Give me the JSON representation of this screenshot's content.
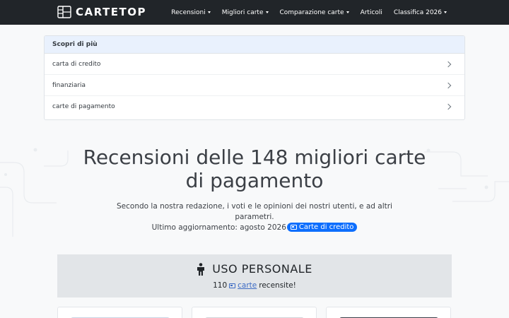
{
  "navbar": {
    "brand": "CARTETOP",
    "items": [
      {
        "label": "Recensioni",
        "dropdown": true
      },
      {
        "label": "Migliori carte",
        "dropdown": true
      },
      {
        "label": "Comparazione carte",
        "dropdown": true
      },
      {
        "label": "Articoli",
        "dropdown": false
      },
      {
        "label": "Classifica 2026",
        "dropdown": true
      }
    ]
  },
  "learn_more": {
    "header": "Scopri di più",
    "rows": [
      "carta di credito",
      "finanziaria",
      "carte di pagamento"
    ]
  },
  "hero": {
    "title": "Recensioni delle 148 migliori carte di pagamento",
    "subtitle": "Secondo la nostra redazione, i voti e le opinioni dei nostri utenti, e ad altri parametri.",
    "updated": "Ultimo aggiornamento: agosto 2026",
    "badge": "Carte di credito"
  },
  "section": {
    "title": "USO PERSONALE",
    "count": "110",
    "link": "carte",
    "suffix": "recensite!"
  },
  "colors": {
    "navbar": "#212529",
    "accent": "#0d6efd",
    "link": "#3d6bc4",
    "header_bg": "#e9f1fd",
    "section_bg": "#e2e5e8"
  },
  "icons": [
    "brand-logo-icon",
    "chevron-right-icon",
    "credit-card-icon",
    "person-icon",
    "caret-down-icon"
  ]
}
